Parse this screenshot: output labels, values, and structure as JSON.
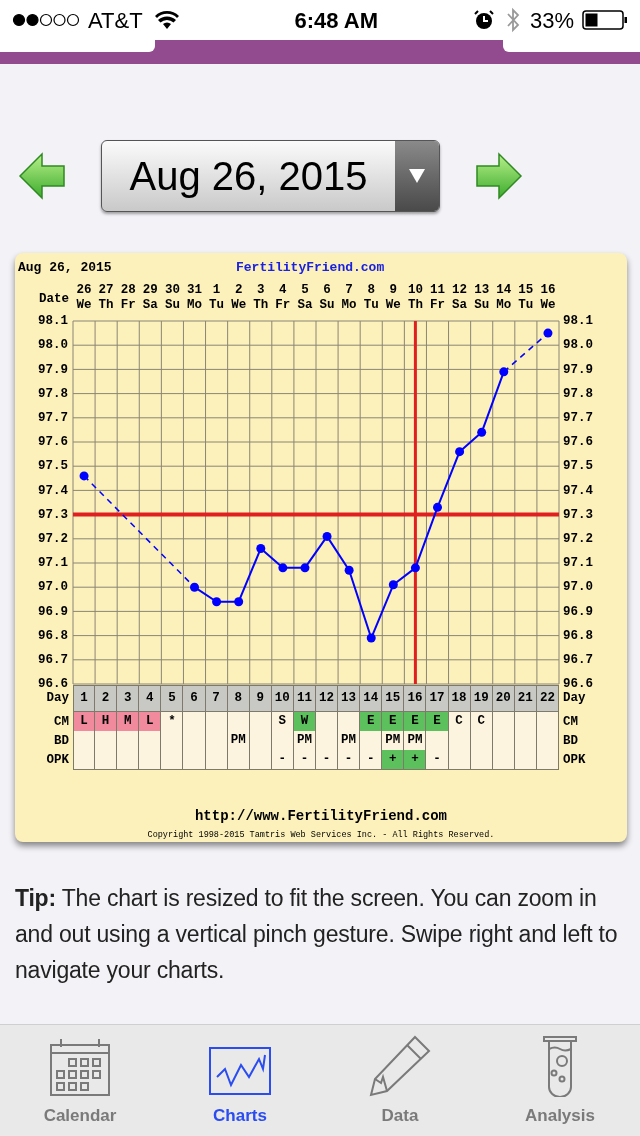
{
  "status_bar": {
    "carrier": "AT&T",
    "time": "6:48 AM",
    "battery": "33%"
  },
  "date_picker": {
    "value": "Aug 26, 2015"
  },
  "chart": {
    "date": "Aug 26, 2015",
    "site": "FertilityFriend.com",
    "date_label": "Date",
    "weekdays": [
      "We",
      "Th",
      "Fr",
      "Sa",
      "Su",
      "Mo",
      "Tu",
      "We",
      "Th",
      "Fr",
      "Sa",
      "Su",
      "Mo",
      "Tu",
      "We",
      "Th",
      "Fr",
      "Sa",
      "Su",
      "Mo",
      "Tu",
      "We"
    ],
    "chart_data": {
      "type": "line",
      "categories": [
        "26",
        "27",
        "28",
        "29",
        "30",
        "31",
        "1",
        "2",
        "3",
        "4",
        "5",
        "6",
        "7",
        "8",
        "9",
        "10",
        "11",
        "12",
        "13",
        "14",
        "15",
        "16"
      ],
      "grid": true,
      "series": [
        {
          "color": "#0000ff",
          "marker": "o",
          "values": [
            97.46,
            null,
            null,
            null,
            null,
            97.0,
            96.94,
            96.94,
            97.16,
            97.08,
            97.08,
            97.21,
            97.07,
            96.79,
            97.01,
            97.08,
            97.33,
            97.56,
            97.64,
            97.89,
            null,
            98.05
          ]
        }
      ],
      "ylim": [
        96.6,
        98.1
      ],
      "yticks": [
        {
          "value": 98.1,
          "label": "98.1"
        },
        {
          "value": 98.0,
          "label": "98.0"
        },
        {
          "value": 97.9,
          "label": "97.9"
        },
        {
          "value": 97.8,
          "label": "97.8"
        },
        {
          "value": 97.7,
          "label": "97.7"
        },
        {
          "value": 97.6,
          "label": "97.6"
        },
        {
          "value": 97.5,
          "label": "97.5"
        },
        {
          "value": 97.4,
          "label": "97.4"
        },
        {
          "value": 97.3,
          "label": "97.3"
        },
        {
          "value": 97.2,
          "label": "97.2"
        },
        {
          "value": 97.1,
          "label": "97.1"
        },
        {
          "value": 97.0,
          "label": "97.0"
        },
        {
          "value": 96.9,
          "label": "96.9"
        },
        {
          "value": 96.8,
          "label": "96.8"
        },
        {
          "value": 96.7,
          "label": "96.7"
        },
        {
          "value": 96.6,
          "label": "96.6"
        }
      ],
      "y2ticks": [
        "98.1",
        "98.0",
        "97.9",
        "97.8",
        "97.7",
        "97.6",
        "97.5",
        "97.4",
        "97.3",
        "97.2",
        "97.1",
        "97.0",
        "96.9",
        "96.8",
        "96.7",
        "96.6"
      ],
      "ref_lines": [
        {
          "axis": "y",
          "value": 97.3,
          "color": "#e02020"
        },
        {
          "axis": "x",
          "value": "10",
          "color": "#e02020"
        }
      ]
    },
    "rows": [
      {
        "kind": "header",
        "label": "Day",
        "label_right": "Day",
        "cells": [
          {
            "text": "1"
          },
          {
            "text": "2"
          },
          {
            "text": "3"
          },
          {
            "text": "4"
          },
          {
            "text": "5"
          },
          {
            "text": "6"
          },
          {
            "text": "7"
          },
          {
            "text": "8"
          },
          {
            "text": "9"
          },
          {
            "text": "10"
          },
          {
            "text": "11"
          },
          {
            "text": "12"
          },
          {
            "text": "13"
          },
          {
            "text": "14"
          },
          {
            "text": "15"
          },
          {
            "text": "16"
          },
          {
            "text": "17"
          },
          {
            "text": "18"
          },
          {
            "text": "19"
          },
          {
            "text": "20"
          },
          {
            "text": "21"
          },
          {
            "text": "22"
          }
        ]
      },
      {
        "kind": "data",
        "label": "CM",
        "label_right": "CM",
        "cells": [
          {
            "text": "L",
            "color": "#f08a9c"
          },
          {
            "text": "H",
            "color": "#f08a9c"
          },
          {
            "text": "M",
            "color": "#f08a9c"
          },
          {
            "text": "L",
            "color": "#f08a9c"
          },
          {
            "text": "*"
          },
          {},
          {},
          {},
          {},
          {
            "text": "S"
          },
          {
            "text": "W",
            "color": "#5cc05c"
          },
          {},
          {},
          {
            "text": "E",
            "color": "#5cc05c"
          },
          {
            "text": "E",
            "color": "#5cc05c"
          },
          {
            "text": "E",
            "color": "#5cc05c"
          },
          {
            "text": "E",
            "color": "#5cc05c"
          },
          {
            "text": "C"
          },
          {
            "text": "C"
          },
          {},
          {},
          {}
        ]
      },
      {
        "kind": "data",
        "label": "BD",
        "label_right": "BD",
        "cells": [
          {},
          {},
          {},
          {},
          {},
          {},
          {},
          {
            "text": "PM"
          },
          {},
          {},
          {
            "text": "PM"
          },
          {},
          {
            "text": "PM"
          },
          {},
          {
            "text": "PM"
          },
          {
            "text": "PM"
          },
          {},
          {},
          {},
          {},
          {},
          {}
        ]
      },
      {
        "kind": "data",
        "label": "OPK",
        "label_right": "OPK",
        "cells": [
          {},
          {},
          {},
          {},
          {},
          {},
          {},
          {},
          {},
          {
            "text": "-"
          },
          {
            "text": "-"
          },
          {
            "text": "-"
          },
          {
            "text": "-"
          },
          {
            "text": "-"
          },
          {
            "text": "+",
            "color": "#5cc05c"
          },
          {
            "text": "+",
            "color": "#5cc05c"
          },
          {
            "text": "-"
          },
          {},
          {},
          {},
          {},
          {}
        ]
      }
    ],
    "url": "http://www.FertilityFriend.com",
    "copyright": "Copyright 1998-2015 Tamtris Web Services Inc. - All Rights Reserved."
  },
  "tip": "**Tip:** The chart is resized to fit the screen. You can zoom in and out using a vertical pinch gesture. Swipe right and left to navigate your charts.",
  "tabs": [
    {
      "kind": "calendar",
      "label": "Calendar",
      "selected": false
    },
    {
      "kind": "charts",
      "label": "Charts",
      "selected": true
    },
    {
      "kind": "data",
      "label": "Data",
      "selected": false
    },
    {
      "kind": "analysis",
      "label": "Analysis",
      "selected": false
    }
  ]
}
